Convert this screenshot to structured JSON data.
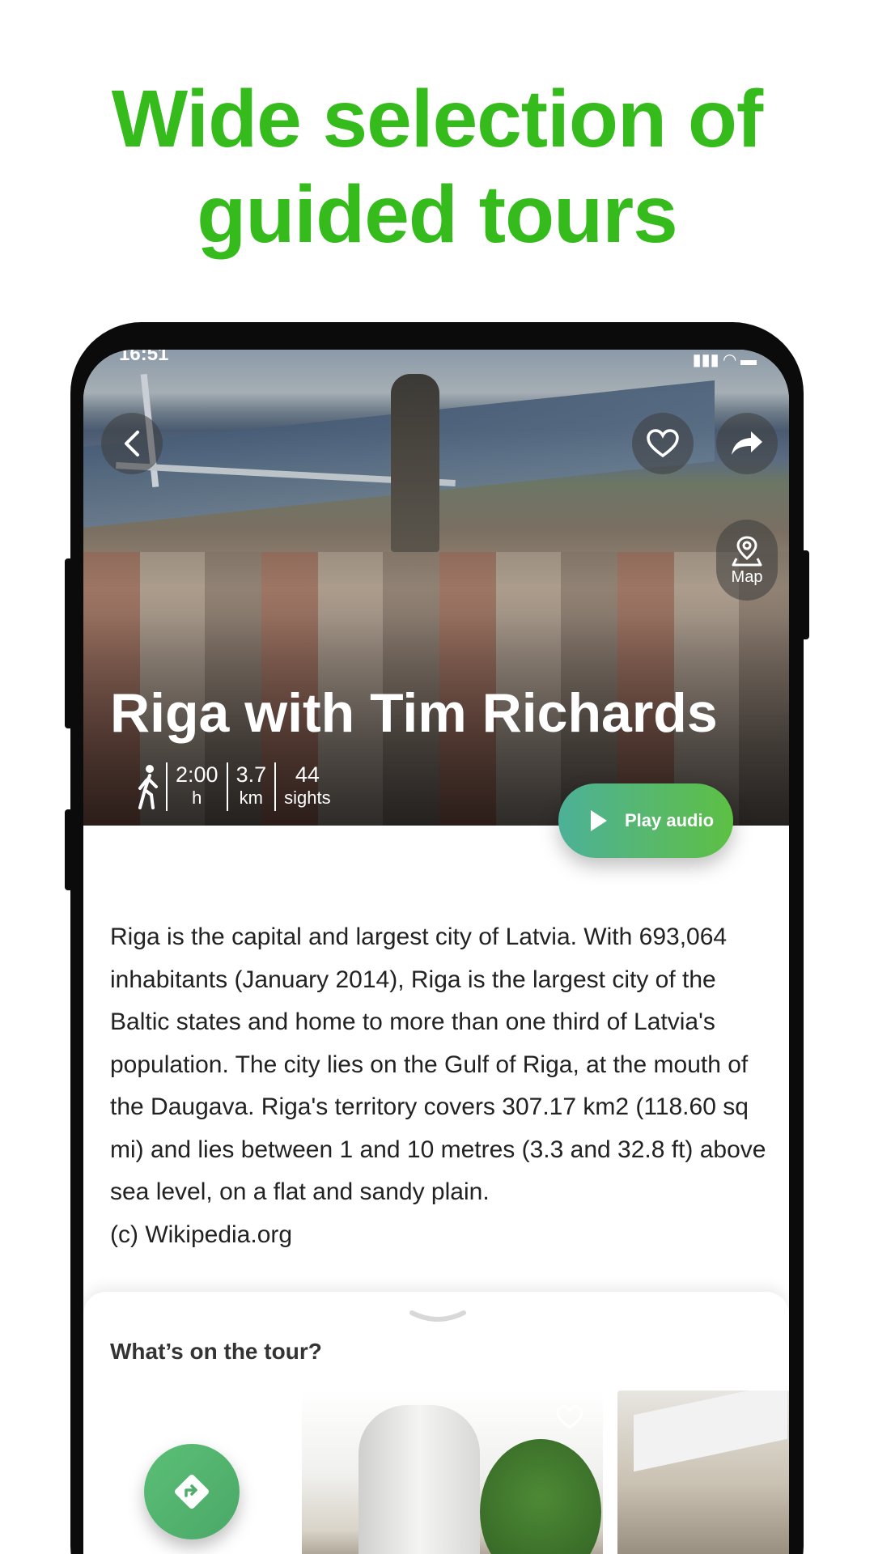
{
  "headline": {
    "line1": "Wide selection of",
    "line2": "guided tours"
  },
  "status_bar": {
    "time": "16:51",
    "icons": "signal-wifi-battery"
  },
  "tour": {
    "title": "Riga with Tim Richards",
    "stats": [
      {
        "value": "2:00",
        "unit": "h"
      },
      {
        "value": "3.7",
        "unit": "km"
      },
      {
        "value": "44",
        "unit": "sights"
      }
    ],
    "play_label": "Play audio",
    "map_label": "Map",
    "description": "Riga is the capital and largest city of Latvia. With 693,064 inhabitants (January 2014), Riga is the largest city of the Baltic states and home to more than one third of Latvia's population. The city lies on the Gulf of Riga, at the mouth of the Daugava. Riga's territory covers 307.17 km2 (118.60 sq mi) and lies between 1 and 10 metres (3.3 and 32.8 ft) above sea level, on a flat and sandy plain.",
    "credit": "(c) Wikipedia.org"
  },
  "sheet": {
    "title": "What’s on the tour?"
  },
  "colors": {
    "headline": "#35bb1c",
    "play_gradient_start": "#4cb198",
    "play_gradient_end": "#5cc043"
  },
  "icons": [
    "back-arrow-icon",
    "heart-icon",
    "share-icon",
    "map-pin-icon",
    "walker-icon",
    "play-icon",
    "chevron-down-icon",
    "route-icon"
  ]
}
